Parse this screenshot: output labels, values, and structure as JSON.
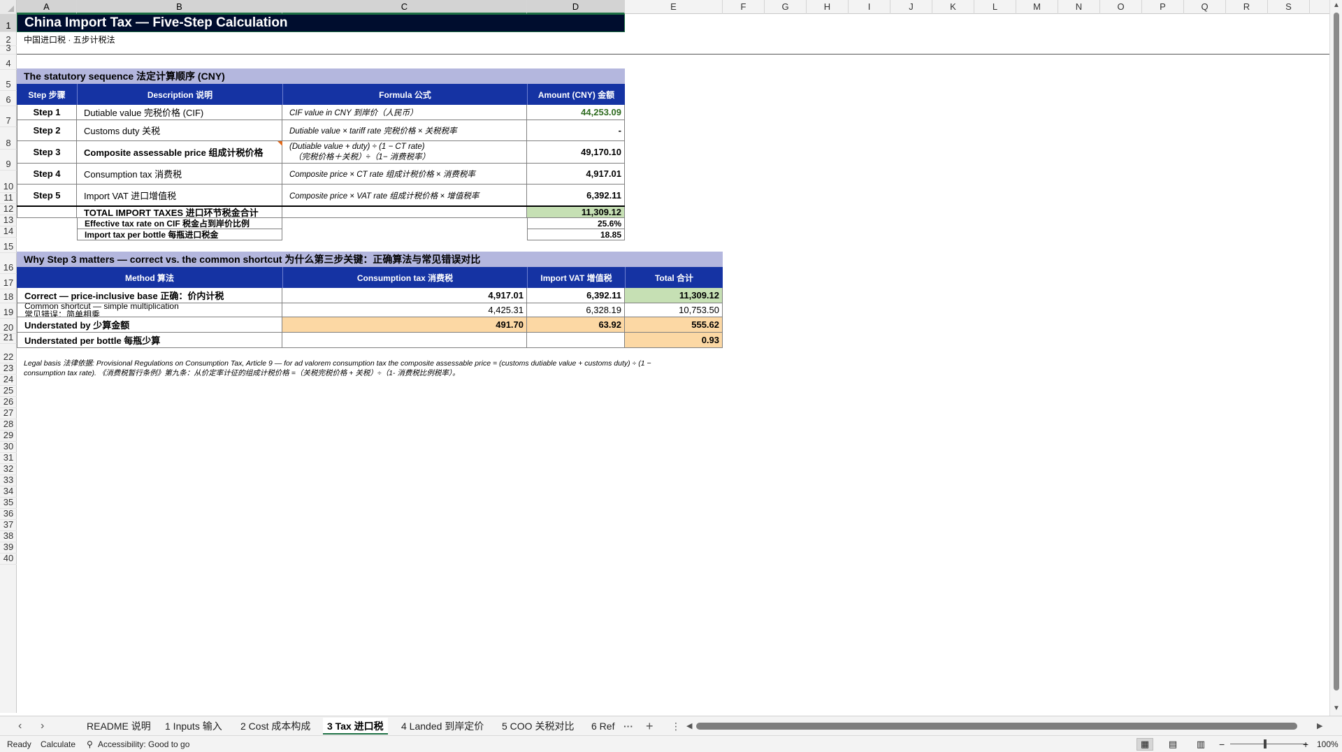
{
  "columns": [
    "A",
    "B",
    "C",
    "D",
    "E",
    "F",
    "G",
    "H",
    "I",
    "J",
    "K",
    "L",
    "M",
    "N",
    "O",
    "P",
    "Q",
    "R",
    "S"
  ],
  "rows": [
    "1",
    "2",
    "3",
    "4",
    "5",
    "6",
    "7",
    "8",
    "9",
    "10",
    "11",
    "12",
    "13",
    "14",
    "15",
    "16",
    "17",
    "18",
    "19",
    "20",
    "21",
    "22",
    "23",
    "24",
    "25",
    "26",
    "27",
    "28",
    "29",
    "30",
    "31",
    "32",
    "33",
    "34",
    "35",
    "36",
    "37",
    "38",
    "39",
    "40"
  ],
  "sheet": {
    "title": "China Import Tax — Five-Step Calculation",
    "subtitle": "中国进口税 · 五步计税法",
    "section1_title": "The statutory sequence  法定计算顺序  (CNY)",
    "table1_headers": [
      "Step  步骤",
      "Description  说明",
      "Formula  公式",
      "Amount (CNY)  金额"
    ],
    "steps": [
      {
        "step": "Step 1",
        "desc": "Dutiable value  完税价格 (CIF)",
        "formula": "CIF value in CNY  到岸价（人民币）",
        "formula2": "",
        "amount": "44,253.09"
      },
      {
        "step": "Step 2",
        "desc": "Customs duty  关税",
        "formula": "Dutiable value × tariff rate  完税价格 × 关税税率",
        "formula2": "",
        "amount": "-"
      },
      {
        "step": "Step 3",
        "desc": "Composite assessable price  组成计税价格",
        "formula": "(Dutiable value + duty) ÷ (1 − CT rate)",
        "formula2": "（完税价格＋关税）÷（1− 消费税率）",
        "amount": "49,170.10"
      },
      {
        "step": "Step 4",
        "desc": "Consumption tax  消费税",
        "formula": "Composite price × CT rate  组成计税价格 × 消费税率",
        "formula2": "",
        "amount": "4,917.01"
      },
      {
        "step": "Step 5",
        "desc": "Import VAT  进口增值税",
        "formula": "Composite price × VAT rate  组成计税价格 × 增值税率",
        "formula2": "",
        "amount": "6,392.11"
      }
    ],
    "total_label": "TOTAL IMPORT TAXES  进口环节税金合计",
    "total_value": "11,309.12",
    "eff_label": "Effective tax rate on CIF  税金占到岸价比例",
    "eff_value": "25.6%",
    "perbottle_label": "Import tax per bottle  每瓶进口税金",
    "perbottle_value": "18.85",
    "section2_title": "Why Step 3 matters — correct vs. the common shortcut  为什么第三步关键：正确算法与常见错误对比",
    "table2_headers": [
      "Method  算法",
      "Consumption tax  消费税",
      "Import VAT  增值税",
      "Total  合计"
    ],
    "compare": [
      {
        "method": "Correct — price-inclusive base  正确：价内计税",
        "method2": "",
        "ct": "4,917.01",
        "vat": "6,392.11",
        "total": "11,309.12"
      },
      {
        "method": "Common shortcut — simple multiplication",
        "method2": "常见错误：简单相乘",
        "ct": "4,425.31",
        "vat": "6,328.19",
        "total": "10,753.50"
      },
      {
        "method": "Understated by  少算金额",
        "method2": "",
        "ct": "491.70",
        "vat": "63.92",
        "total": "555.62"
      },
      {
        "method": "Understated per bottle  每瓶少算",
        "method2": "",
        "ct": "",
        "vat": "",
        "total": "0.93"
      }
    ],
    "legal_line1": "Legal basis  法律依据: Provisional Regulations on Consumption Tax, Article 9 — for ad valorem consumption tax the composite assessable price = (customs dutiable value + customs duty) ÷ (1 −",
    "legal_line2": "consumption tax rate).  《消费税暂行条例》第九条：从价定率计征的组成计税价格 =（关税完税价格 + 关税）÷（1- 消费税比例税率）。"
  },
  "tabs": [
    "README 说明",
    "1 Inputs 输入",
    "2 Cost 成本构成",
    "3 Tax 进口税",
    "4 Landed 到岸定价",
    "5 COO 关税对比",
    "6 Ref"
  ],
  "active_tab": "3 Tax 进口税",
  "tab_more": "···",
  "tab_add": "+",
  "tab_options": "⋮",
  "status": {
    "ready": "Ready",
    "calculate": "Calculate",
    "accessibility": "Accessibility: Good to go",
    "zoom": "100%"
  },
  "colors": {
    "header_blue": "#1533a3",
    "band": "#b4b7de",
    "title_bg": "#000d2e",
    "green": "#c6e0b4",
    "peach": "#fcd8a4",
    "value_green": "#2e6b1f"
  }
}
